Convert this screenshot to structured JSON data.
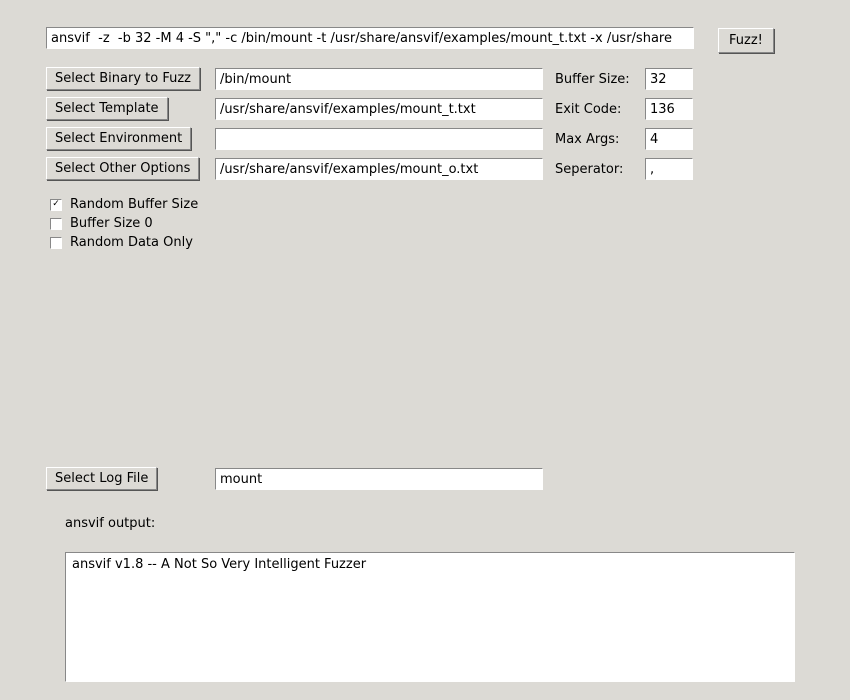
{
  "command_line": "ansvif  -z  -b 32 -M 4 -S \",\" -c /bin/mount -t /usr/share/ansvif/examples/mount_t.txt -x /usr/share",
  "fuzz_button": "Fuzz!",
  "buttons": {
    "select_binary": "Select Binary to Fuzz",
    "select_template": "Select Template",
    "select_environment": "Select Environment",
    "select_other": "Select Other Options",
    "select_log": "Select Log File"
  },
  "inputs": {
    "binary": "/bin/mount",
    "template": "/usr/share/ansvif/examples/mount_t.txt",
    "environment": "",
    "other": "/usr/share/ansvif/examples/mount_o.txt",
    "log": "mount"
  },
  "labels": {
    "buffer_size": "Buffer Size:",
    "exit_code": "Exit Code:",
    "max_args": "Max Args:",
    "seperator": "Seperator:"
  },
  "values": {
    "buffer_size": "32",
    "exit_code": "136",
    "max_args": "4",
    "seperator": ","
  },
  "checkboxes": {
    "random_buffer_size": {
      "label": "Random Buffer Size",
      "checked": true
    },
    "buffer_size_0": {
      "label": "Buffer Size 0",
      "checked": false
    },
    "random_data_only": {
      "label": "Random Data Only",
      "checked": false
    }
  },
  "output_label": "ansvif output:",
  "output_text": "ansvif v1.8 -- A Not So Very Intelligent Fuzzer"
}
